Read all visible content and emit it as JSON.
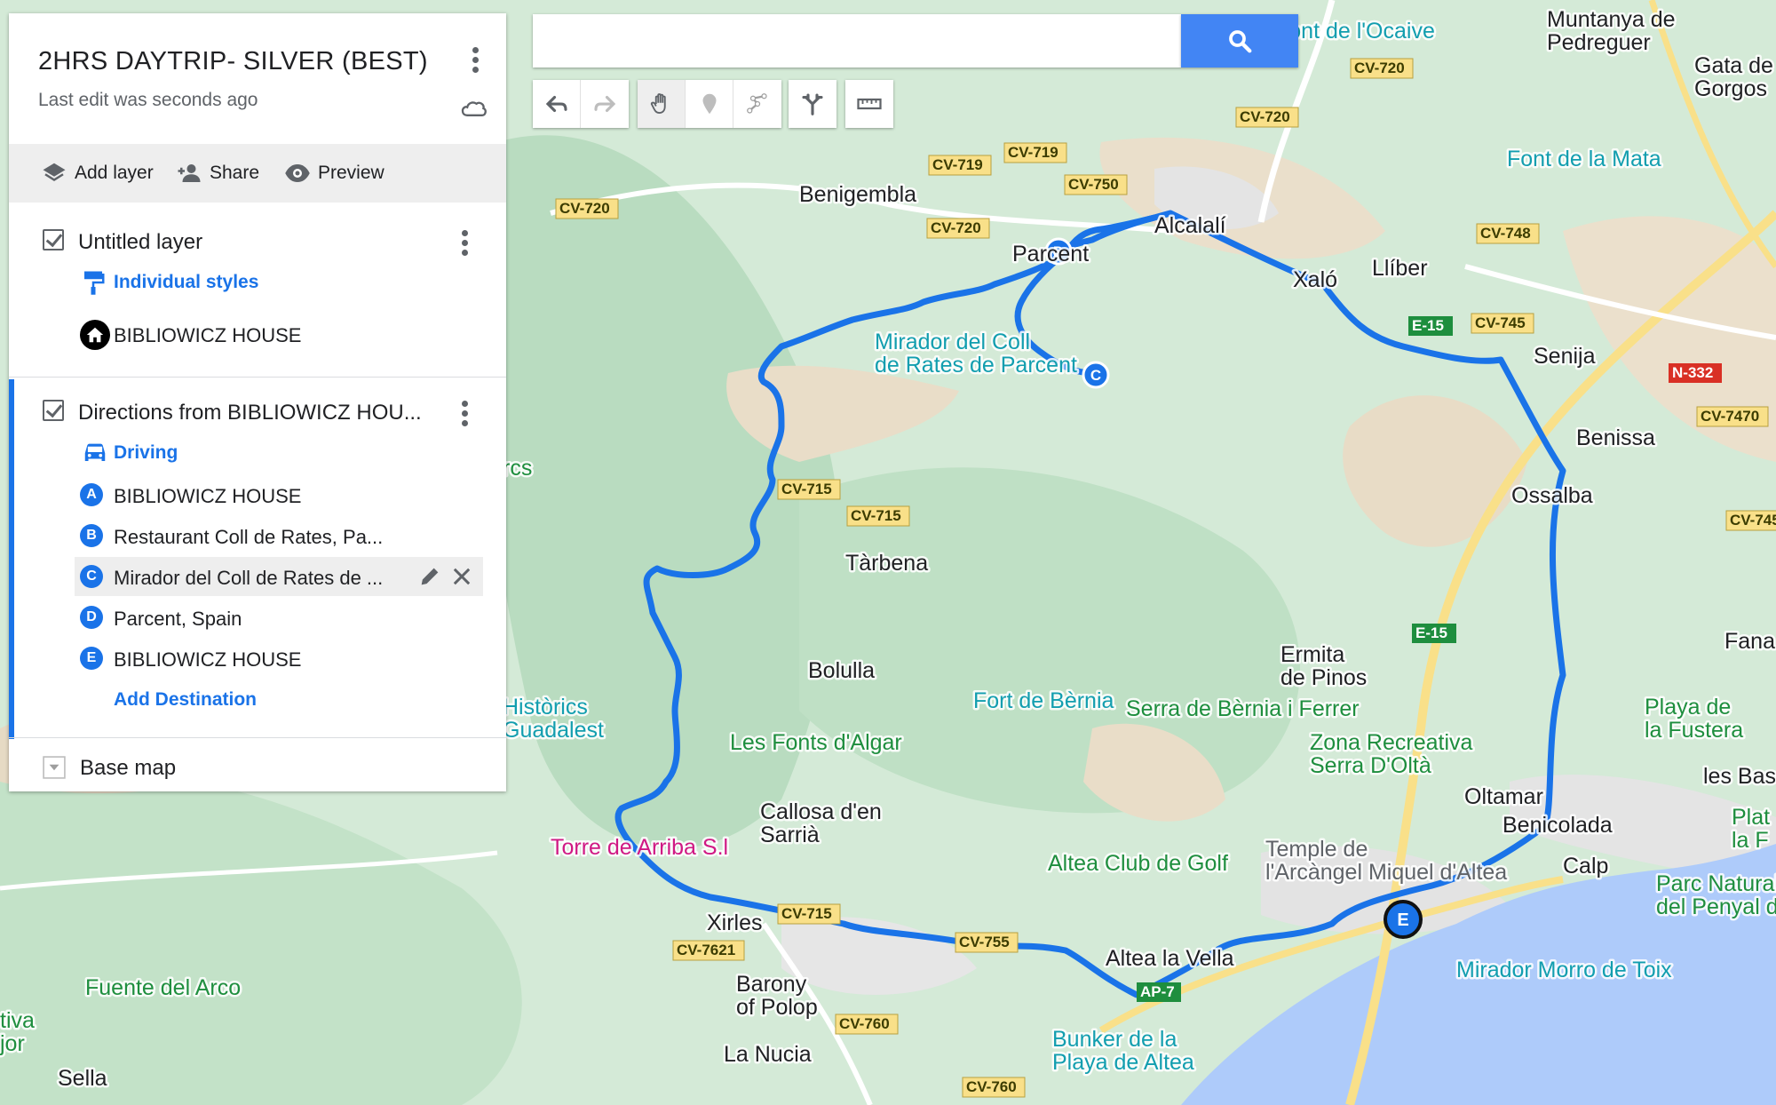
{
  "panel": {
    "title": "2HRS DAYTRIP- SILVER (BEST)",
    "last_edit": "Last edit was seconds ago",
    "actions": {
      "add_layer": "Add layer",
      "share": "Share",
      "preview": "Preview"
    },
    "layer1": {
      "name": "Untitled layer",
      "style": "Individual styles",
      "items": [
        {
          "label": "BIBLIOWICZ HOUSE",
          "icon": "home-icon"
        }
      ]
    },
    "layer2": {
      "name": "Directions from BIBLIOWICZ HOU...",
      "mode": "Driving",
      "stops": [
        {
          "marker": "A",
          "label": "BIBLIOWICZ HOUSE"
        },
        {
          "marker": "B",
          "label": "Restaurant Coll de Rates, Pa..."
        },
        {
          "marker": "C",
          "label": "Mirador del Coll de Rates de ..."
        },
        {
          "marker": "D",
          "label": "Parcent, Spain"
        },
        {
          "marker": "E",
          "label": "BIBLIOWICZ HOUSE"
        }
      ],
      "add_destination": "Add Destination"
    },
    "base_map": "Base map"
  },
  "search": {
    "value": "",
    "placeholder": ""
  },
  "colors": {
    "route": "#1a73e8",
    "accent": "#4285f4",
    "water": "#aecbfa",
    "land": "#cfe8d4",
    "terrain": "#e8dcc6"
  },
  "map": {
    "places": [
      "Benigembla",
      "Parcent",
      "Alcalalí",
      "Xaló",
      "Llíber",
      "Senija",
      "Benissa",
      "Ossalba",
      "Tàrbena",
      "Bolulla",
      "Callosa d'en Sarrià",
      "Xirles",
      "Barony of Polop",
      "La Nucia",
      "Altea la Vella",
      "Calp",
      "Oltamar",
      "Benicolada",
      "Sella",
      "Ermita de Pinos",
      "Muntanya de Pedreguer",
      "Gata de Gorgos",
      "Fana",
      "les Basse"
    ],
    "pois": [
      "Mirador del Coll de Rates de Parcent",
      "Font de la Mata",
      "Font de l'Ocaive",
      "Fort de Bèrnia",
      "Serra de Bèrnia i Ferrer",
      "Les Fonts d'Algar",
      "Zona Recreativa Serra D'Oltà",
      "Torre de Arriba S.l",
      "Altea Club de Golf",
      "Temple de l'Arcàngel Miquel d'Altea",
      "Parc Natural del Penyal d'Ifac",
      "Mirador Morro de Toix",
      "Bunker de la Playa de Altea",
      "Fuente del Arco",
      "Històrics Guadalest",
      "Playa de la Fustera",
      "Plat la F",
      "rcs",
      "tiva jor"
    ],
    "roads": [
      "CV-720",
      "CV-719",
      "CV-750",
      "CV-748",
      "CV-745",
      "CV-715",
      "CV-7470",
      "CV-7621",
      "CV-760",
      "E-15",
      "N-332",
      "AP-7",
      "CV-755"
    ]
  }
}
